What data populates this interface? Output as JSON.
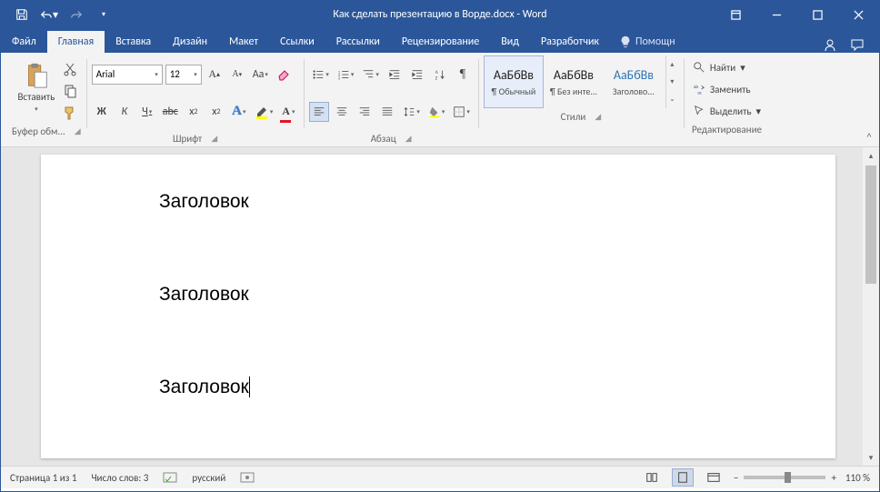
{
  "titlebar": {
    "title": "Как сделать презентацию в Ворде.docx - Word"
  },
  "tabs": {
    "file": "Файл",
    "home": "Главная",
    "insert": "Вставка",
    "design": "Дизайн",
    "layout": "Макет",
    "references": "Ссылки",
    "mailings": "Рассылки",
    "review": "Рецензирование",
    "view": "Вид",
    "developer": "Разработчик",
    "tell_me": "Помощн"
  },
  "ribbon": {
    "clipboard": {
      "paste": "Вставить",
      "group": "Буфер обм..."
    },
    "font": {
      "name": "Arial",
      "size": "12",
      "group": "Шрифт",
      "bold": "Ж",
      "italic": "К",
      "underline": "Ч",
      "aa": "Aa"
    },
    "paragraph": {
      "group": "Абзац"
    },
    "styles": {
      "group": "Стили",
      "sample": "АаБбВв",
      "normal": "¶ Обычный",
      "no_spacing": "¶ Без инте...",
      "heading1": "Заголово..."
    },
    "editing": {
      "group": "Редактирование",
      "find": "Найти",
      "replace": "Заменить",
      "select": "Выделить"
    }
  },
  "document": {
    "h1": "Заголовок",
    "h2": "Заголовок",
    "h3": "Заголовок"
  },
  "status": {
    "page": "Страница 1 из 1",
    "words": "Число слов: 3",
    "lang": "русский",
    "zoom": "110 %"
  }
}
